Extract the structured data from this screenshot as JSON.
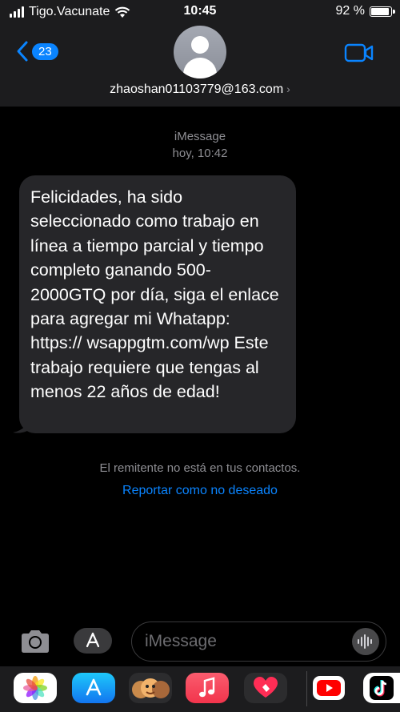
{
  "status_bar": {
    "carrier": "Tigo.Vacunate",
    "time": "10:45",
    "battery_percent": "92 %",
    "battery_level": 0.92
  },
  "header": {
    "back_badge": "23",
    "contact": "zhaoshan01103779@163.com"
  },
  "conversation": {
    "service": "iMessage",
    "timestamp": "hoy, 10:42",
    "messages": [
      {
        "direction": "incoming",
        "text": "Felicidades, ha sido seleccionado como trabajo en línea a tiempo parcial y tiempo completo ganando 500-2000GTQ por día, siga el enlace para agregar mi Whatapp: https:// wsappgtm.com/wp  Este trabajo requiere que tengas al menos 22 años de edad!"
      }
    ],
    "sender_note": "El remitente no está en tus contactos.",
    "report_link": "Reportar como no deseado"
  },
  "compose": {
    "placeholder": "iMessage"
  },
  "app_drawer": {
    "apps": [
      "photos-icon",
      "app-store-icon",
      "memoji-icon",
      "music-icon",
      "heart-digital-touch-icon",
      "youtube-icon",
      "tiktok-icon"
    ]
  },
  "colors": {
    "accent": "#0a84ff",
    "bubble": "#262629",
    "bar_bg": "#1c1c1e",
    "secondary_text": "#8e8e93"
  }
}
